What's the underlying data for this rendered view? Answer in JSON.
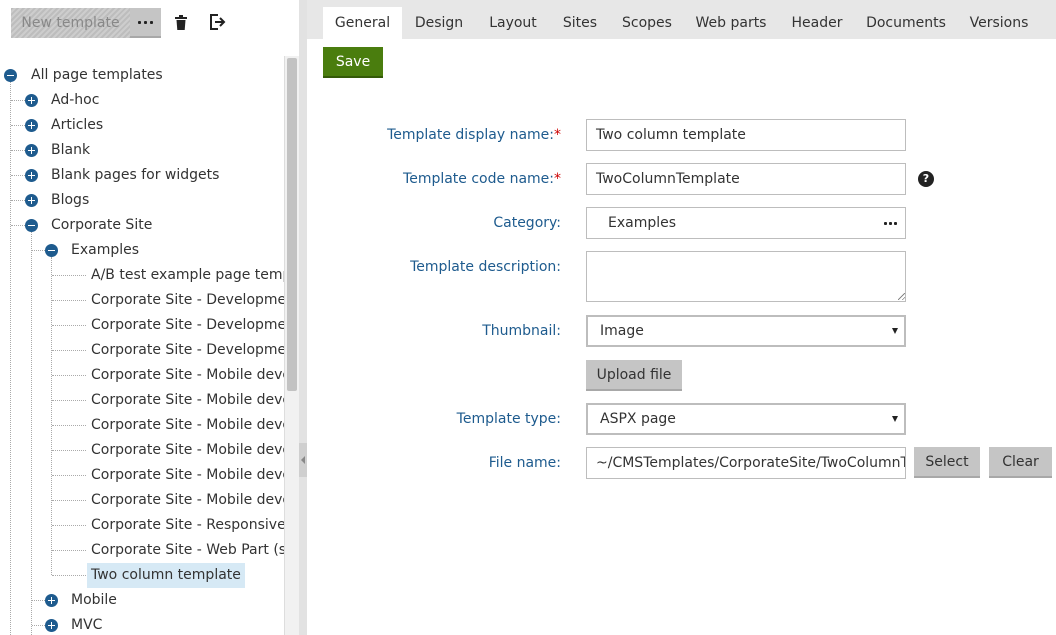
{
  "toolbar": {
    "new_template_label": "New template",
    "more_icon": "ellipsis-icon",
    "delete_icon": "trash-icon",
    "export_icon": "sign-out-icon"
  },
  "tree": {
    "root": "All page templates",
    "level1": [
      "Ad-hoc",
      "Articles",
      "Blank",
      "Blank pages for widgets",
      "Blogs",
      "Corporate Site"
    ],
    "examples_label": "Examples",
    "example_items": [
      "A/B test example page template",
      "Corporate Site - Development mode",
      "Corporate Site - Development mode",
      "Corporate Site - Development mode",
      "Corporate Site - Mobile development",
      "Corporate Site - Mobile development",
      "Corporate Site - Mobile development",
      "Corporate Site - Mobile development",
      "Corporate Site - Mobile development",
      "Corporate Site - Mobile development",
      "Corporate Site - Responsive Master",
      "Corporate Site - Web Part (sample)",
      "Two column template"
    ],
    "after": [
      "Mobile",
      "MVC"
    ]
  },
  "tabs": [
    "General",
    "Design",
    "Layout",
    "Sites",
    "Scopes",
    "Web parts",
    "Header",
    "Documents",
    "Versions"
  ],
  "active_tab": "General",
  "form": {
    "save_label": "Save",
    "display_name_label": "Template display name:",
    "display_name_value": "Two column template",
    "code_name_label": "Template code name:",
    "code_name_value": "TwoColumnTemplate",
    "category_label": "Category:",
    "category_value": "Examples",
    "description_label": "Template description:",
    "description_value": "",
    "thumbnail_label": "Thumbnail:",
    "thumbnail_value": "Image",
    "upload_label": "Upload file",
    "template_type_label": "Template type:",
    "template_type_value": "ASPX page",
    "file_name_label": "File name:",
    "file_name_value": "~/CMSTemplates/CorporateSite/TwoColumnTemplate.aspx",
    "select_label": "Select",
    "clear_label": "Clear",
    "required_mark": "*",
    "help_mark": "?"
  },
  "colors": {
    "accent": "#1e5b8e",
    "save": "#4a7d0e",
    "selected_row": "#d6e9f5"
  }
}
